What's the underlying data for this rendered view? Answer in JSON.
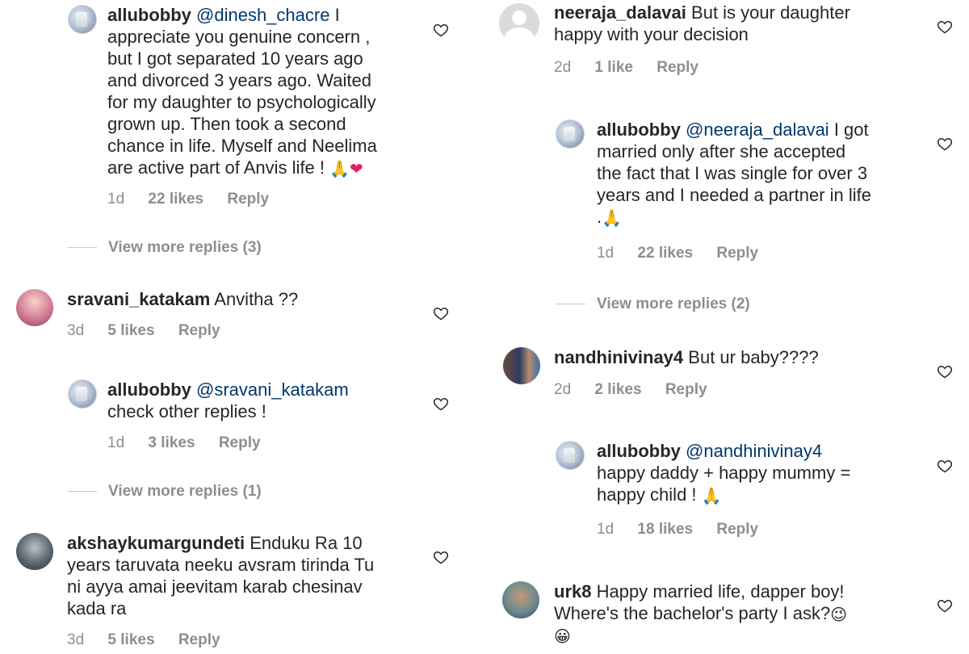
{
  "left_column": {
    "c1": {
      "username": "allubobby",
      "mention": "@dinesh_chacre",
      "text_lines": [
        "I",
        "appreciate you genuine concern ,",
        "but I got separated 10 years ago",
        "and divorced 3 years ago. Waited",
        "for my daughter to psychologically",
        "grown up. Then took a second",
        "chance in life. Myself and Neelima",
        "are active part of Anvis life ! "
      ],
      "emoji_pray": "🙏",
      "emoji_heart": "❤",
      "time": "1d",
      "likes": "22 likes",
      "reply": "Reply",
      "view_more": "View more replies (3)"
    },
    "c2": {
      "username": "sravani_katakam",
      "text": "Anvitha ??",
      "time": "3d",
      "likes": "5 likes",
      "reply": "Reply"
    },
    "c3": {
      "username": "allubobby",
      "mention": "@sravani_katakam",
      "text": "check other replies !",
      "time": "1d",
      "likes": "3 likes",
      "reply": "Reply",
      "view_more": "View more replies (1)"
    },
    "c4": {
      "username": "akshaykumargundeti",
      "text_lines": [
        "Enduku Ra 10",
        "years taruvata neeku avsram tirinda Tu",
        "ni ayya amai jeevitam karab chesinav",
        "kada ra"
      ],
      "time": "3d",
      "likes": "5 likes",
      "reply": "Reply"
    }
  },
  "right_column": {
    "c1": {
      "username": "neeraja_dalavai",
      "text_lines": [
        "But is your daughter",
        "happy with your decision"
      ],
      "time": "2d",
      "likes": "1 like",
      "reply": "Reply"
    },
    "c2": {
      "username": "allubobby",
      "mention": "@neeraja_dalavai",
      "text_lines": [
        "I got",
        "married only after she accepted",
        "the fact that I was single for over 3",
        "years and I needed a partner in life",
        "."
      ],
      "emoji_pray": "🙏",
      "time": "1d",
      "likes": "22 likes",
      "reply": "Reply",
      "view_more": "View more replies (2)"
    },
    "c3": {
      "username": "nandhinivinay4",
      "text": "But ur baby????",
      "time": "2d",
      "likes": "2 likes",
      "reply": "Reply"
    },
    "c4": {
      "username": "allubobby",
      "mention": "@nandhinivinay4",
      "text_lines": [
        "happy daddy + happy mummy =",
        "happy child ! "
      ],
      "emoji_pray": "🙏",
      "time": "1d",
      "likes": "18 likes",
      "reply": "Reply"
    },
    "c5": {
      "username": "urk8",
      "text_lines": [
        "Happy married life, dapper boy!",
        "Where's the bachelor's party I ask?"
      ],
      "emoji_wink": "😉",
      "emoji_grin": "😀"
    }
  },
  "icons": {
    "like": "heart-outline-icon",
    "heart_stroke": "#262626"
  }
}
